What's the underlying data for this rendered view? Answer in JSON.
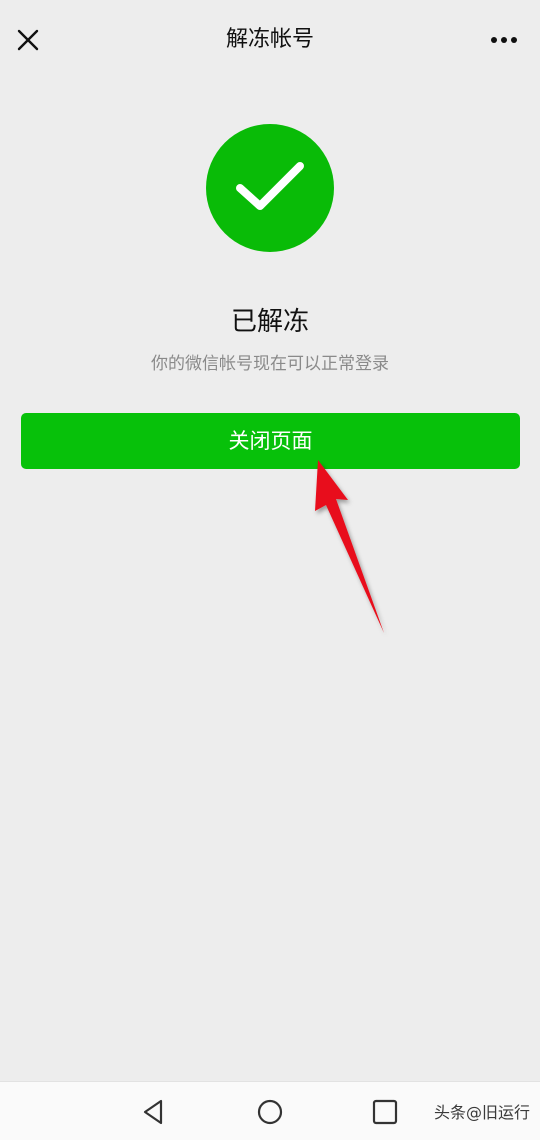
{
  "navbar": {
    "title": "解冻帐号",
    "close_icon": "close-icon",
    "more_icon": "more-icon"
  },
  "result": {
    "icon": "checkmark-circle-icon",
    "title": "已解冻",
    "description": "你的微信帐号现在可以正常登录"
  },
  "actions": {
    "close_page_label": "关闭页面"
  },
  "system_nav": {
    "back_icon": "triangle-back-icon",
    "home_icon": "circle-home-icon",
    "recent_icon": "square-recent-icon"
  },
  "watermark": "头条@旧运行",
  "colors": {
    "brand_green": "#07c10a",
    "background": "#ededed",
    "annotation_arrow": "#e8101a"
  }
}
